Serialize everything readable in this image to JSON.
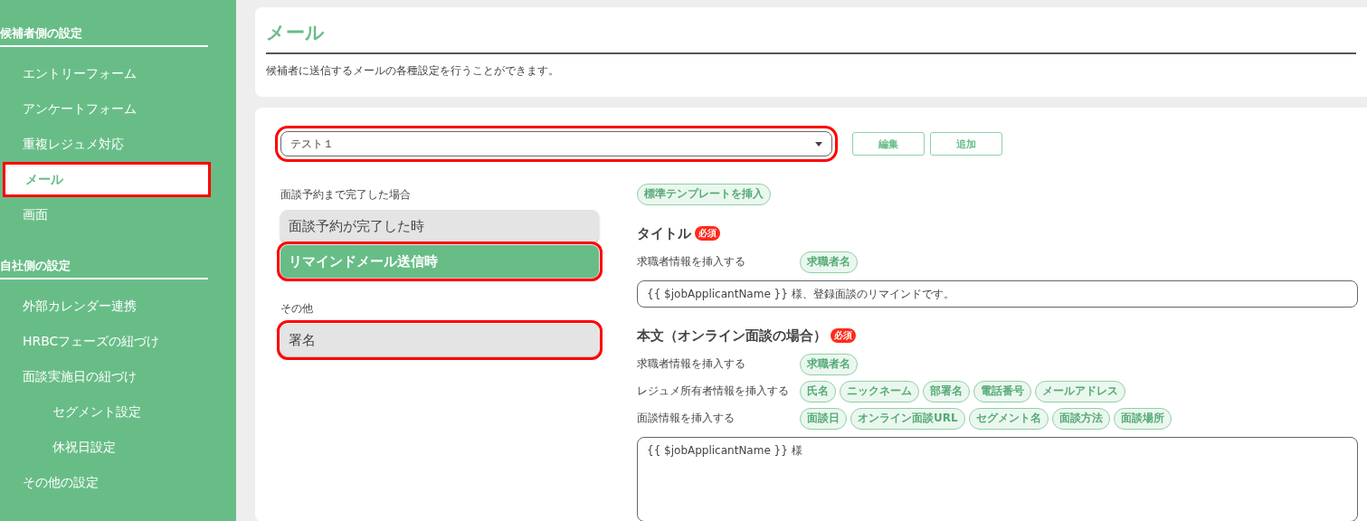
{
  "sidebar": {
    "sections": [
      {
        "title": "候補者側の設定",
        "items": [
          {
            "label": "エントリーフォーム",
            "selected": false,
            "highlighted": false
          },
          {
            "label": "アンケートフォーム",
            "selected": false,
            "highlighted": false
          },
          {
            "label": "重複レジュメ対応",
            "selected": false,
            "highlighted": false
          },
          {
            "label": "メール",
            "selected": true,
            "highlighted": true
          },
          {
            "label": "画面",
            "selected": false,
            "highlighted": false
          }
        ]
      },
      {
        "title": "自社側の設定",
        "items": [
          {
            "label": "外部カレンダー連携",
            "selected": false,
            "highlighted": false
          },
          {
            "label": "HRBCフェーズの紐づけ",
            "selected": false,
            "highlighted": false
          },
          {
            "label": "面談実施日の紐づけ",
            "selected": false,
            "highlighted": false,
            "children": [
              {
                "label": "セグメント設定",
                "selected": false,
                "highlighted": false
              },
              {
                "label": "休祝日設定",
                "selected": false,
                "highlighted": false
              }
            ]
          },
          {
            "label": "その他の設定",
            "selected": false,
            "highlighted": false
          }
        ]
      }
    ]
  },
  "header": {
    "title": "メール",
    "description": "候補者に送信するメールの各種設定を行うことができます。"
  },
  "template_select": {
    "value": "テスト１",
    "highlighted": true
  },
  "buttons": [
    "編集",
    "追加"
  ],
  "event_groups": [
    {
      "label": "面談予約まで完了した場合",
      "items": [
        {
          "label": "面談予約が完了した時",
          "selected": false,
          "highlighted": false
        },
        {
          "label": "リマインドメール送信時",
          "selected": true,
          "highlighted": true
        }
      ]
    },
    {
      "label": "その他",
      "items": [
        {
          "label": "署名",
          "selected": false,
          "highlighted": true
        }
      ]
    }
  ],
  "insert_template_button": "標準テンプレートを挿入",
  "title_section": {
    "heading": "タイトル",
    "required_badge": "必須",
    "insert_rows": [
      {
        "label": "求職者情報を挿入する",
        "tags": [
          "求職者名"
        ]
      }
    ],
    "value": "{{ $jobApplicantName }} 様、登録面談のリマインドです。"
  },
  "body_section": {
    "heading": "本文（オンライン面談の場合）",
    "required_badge": "必須",
    "insert_rows": [
      {
        "label": "求職者情報を挿入する",
        "tags": [
          "求職者名"
        ]
      },
      {
        "label": "レジュメ所有者情報を挿入する",
        "tags": [
          "氏名",
          "ニックネーム",
          "部署名",
          "電話番号",
          "メールアドレス"
        ]
      },
      {
        "label": "面談情報を挿入する",
        "tags": [
          "面談日",
          "オンライン面談URL",
          "セグメント名",
          "面談方法",
          "面談場所"
        ]
      }
    ],
    "value": "{{ $jobApplicantName }} 様"
  }
}
